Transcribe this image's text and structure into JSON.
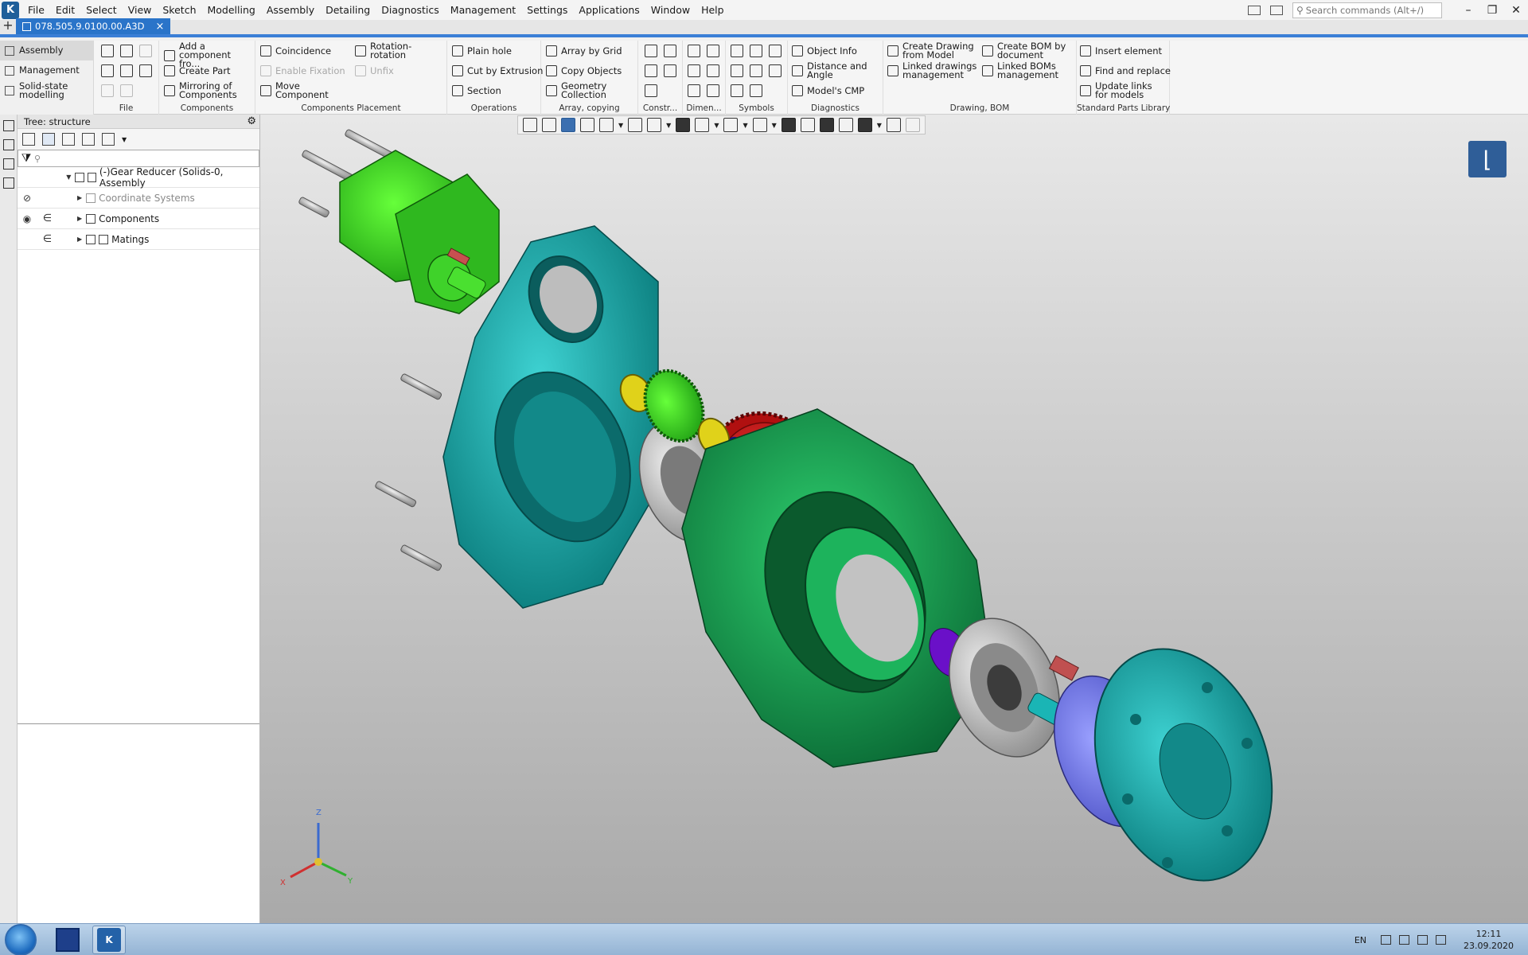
{
  "app": {
    "logo_glyph": "K"
  },
  "menu": [
    "File",
    "Edit",
    "Select",
    "View",
    "Sketch",
    "Modelling",
    "Assembly",
    "Detailing",
    "Diagnostics",
    "Management",
    "Settings",
    "Applications",
    "Window",
    "Help"
  ],
  "search": {
    "placeholder": "Search commands (Alt+/)"
  },
  "tab": {
    "title": "078.505.9.0100.00.A3D",
    "close": "×",
    "new": "+"
  },
  "ribbon": {
    "side": [
      "Assembly",
      "Management",
      "Solid-state modelling"
    ],
    "groups": {
      "file": "File",
      "components": "Components",
      "placement": "Components Placement",
      "operations": "Operations",
      "array": "Array, copying",
      "constr": "Constr...",
      "dimen": "Dimen...",
      "symbols": "Symbols",
      "diagnostics": "Diagnostics",
      "drawing": "Drawing, BOM",
      "std": "Standard Parts Library"
    },
    "buttons": {
      "add_component": "Add a component fro...",
      "create_part": "Create Part",
      "mirroring": "Mirroring of Components",
      "coincidence": "Coincidence",
      "rotation": "Rotation-rotation",
      "enable_fixation": "Enable Fixation",
      "unfix": "Unfix",
      "move_component": "Move Component",
      "plain_hole": "Plain hole",
      "cut_extrusion": "Cut by Extrusion",
      "section": "Section",
      "array_grid": "Array by Grid",
      "copy_objects": "Copy Objects",
      "geometry_collection": "Geometry Collection",
      "object_info": "Object Info",
      "distance_angle": "Distance and Angle",
      "models_cmp": "Model's CMP",
      "create_drawing": "Create Drawing from Model",
      "linked_drawings": "Linked drawings management",
      "create_bom": "Create BOM by document",
      "linked_boms": "Linked BOMs management",
      "insert_element": "Insert element",
      "find_replace": "Find and replace",
      "update_links": "Update links for models"
    }
  },
  "tree": {
    "title": "Tree: structure",
    "filter_placeholder": "",
    "rows": [
      {
        "label": "(-)Gear Reducer (Solids-0, Assembly"
      },
      {
        "label": "Coordinate Systems"
      },
      {
        "label": "Components"
      },
      {
        "label": "Matings"
      }
    ]
  },
  "axes": {
    "x": "X",
    "y": "Y",
    "z": "Z"
  },
  "colors": {
    "accent": "#3b7fd6",
    "teal": "#1fb3b3",
    "green": "#1aa85a",
    "red": "#d01818"
  },
  "taskbar": {
    "lang": "EN",
    "time": "12:11",
    "date": "23.09.2020"
  }
}
